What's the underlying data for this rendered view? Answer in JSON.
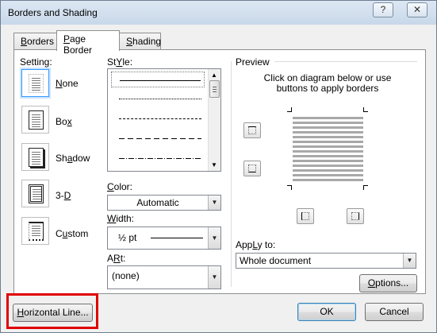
{
  "window": {
    "title": "Borders and Shading"
  },
  "titlebar_buttons": {
    "help": "?",
    "close": "✕"
  },
  "tabs": [
    {
      "label": "Borders",
      "underline": "B",
      "rest": "orders"
    },
    {
      "label": "Page Border",
      "underline": "P",
      "rest": "age Border"
    },
    {
      "label": "Shading",
      "underline": "S",
      "rest": "hading"
    }
  ],
  "setting": {
    "label": "Setting:",
    "options": [
      {
        "u": "N",
        "rest": "one"
      },
      {
        "u": "x",
        "pre": "Bo",
        "rest": ""
      },
      {
        "pre": "Sh",
        "u": "a",
        "rest": "dow"
      },
      {
        "pre": "3-",
        "u": "D",
        "rest": ""
      },
      {
        "pre": "C",
        "u": "u",
        "rest": "stom"
      }
    ]
  },
  "style": {
    "label_u": "Y",
    "label_pre": "St",
    "label_rest": "le:"
  },
  "color": {
    "label_u": "C",
    "label_rest": "olor:",
    "value": "Automatic"
  },
  "width": {
    "label_u": "W",
    "label_rest": "idth:",
    "value": "½ pt"
  },
  "art": {
    "label_u": "R",
    "label_pre": "A",
    "label_rest": "t:",
    "value": "(none)"
  },
  "preview": {
    "label": "Preview",
    "hint_line1": "Click on diagram below or use",
    "hint_line2": "buttons to apply borders"
  },
  "apply_to": {
    "label_u": "L",
    "label_pre": "App",
    "label_rest": "y to:",
    "value": "Whole document"
  },
  "buttons": {
    "options": "Options...",
    "options_u": "O",
    "options_rest": "ptions...",
    "horizontal_line": "Horizontal Line...",
    "hl_u": "H",
    "hl_rest": "orizontal Line...",
    "ok": "OK",
    "cancel": "Cancel"
  }
}
